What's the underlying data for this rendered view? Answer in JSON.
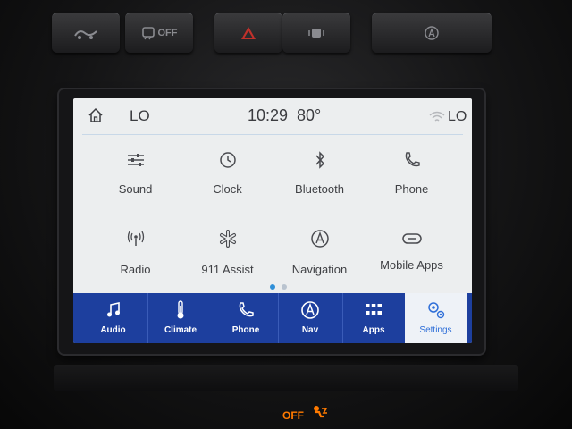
{
  "physical_buttons": [
    {
      "id": "sport-mode",
      "icon": "drive-mode-icon"
    },
    {
      "id": "traction-off",
      "icon": "traction-off-icon",
      "label": "OFF"
    },
    {
      "id": "hazard",
      "icon": "hazard-icon"
    },
    {
      "id": "park-assist",
      "icon": "park-assist-icon"
    },
    {
      "id": "auto-start-stop",
      "icon": "auto-start-stop-icon"
    }
  ],
  "status": {
    "left_level": "LO",
    "time": "10:29",
    "temperature": "80°",
    "right_level": "LO"
  },
  "apps": [
    {
      "label": "Sound",
      "icon": "equalizer-icon"
    },
    {
      "label": "Clock",
      "icon": "clock-icon"
    },
    {
      "label": "Bluetooth",
      "icon": "bluetooth-icon"
    },
    {
      "label": "Phone",
      "icon": "phone-icon"
    },
    {
      "label": "Radio",
      "icon": "radio-antenna-icon"
    },
    {
      "label": "911 Assist",
      "icon": "asterisk-icon"
    },
    {
      "label": "Navigation",
      "icon": "navigation-icon"
    },
    {
      "label": "Mobile Apps",
      "icon": "mobile-apps-icon"
    }
  ],
  "page_indicator": {
    "pages": 2,
    "current": 1
  },
  "nav": [
    {
      "label": "Audio",
      "icon": "music-note-icon"
    },
    {
      "label": "Climate",
      "icon": "thermometer-icon"
    },
    {
      "label": "Phone",
      "icon": "phone-icon"
    },
    {
      "label": "Nav",
      "icon": "navigation-icon"
    },
    {
      "label": "Apps",
      "icon": "apps-grid-icon"
    },
    {
      "label": "Settings",
      "icon": "settings-gear-icon",
      "active": true
    }
  ],
  "dash_indicator": {
    "label": "OFF"
  },
  "colors": {
    "nav_bar": "#1d3f9e",
    "active_tab_bg": "#eef2f7",
    "active_tab_text": "#2f6fd8",
    "screen_bg": "#eceeef",
    "dot_active": "#2f8fd8",
    "dot_inactive": "#b9c3cf",
    "indicator_orange": "#ff7a00"
  }
}
